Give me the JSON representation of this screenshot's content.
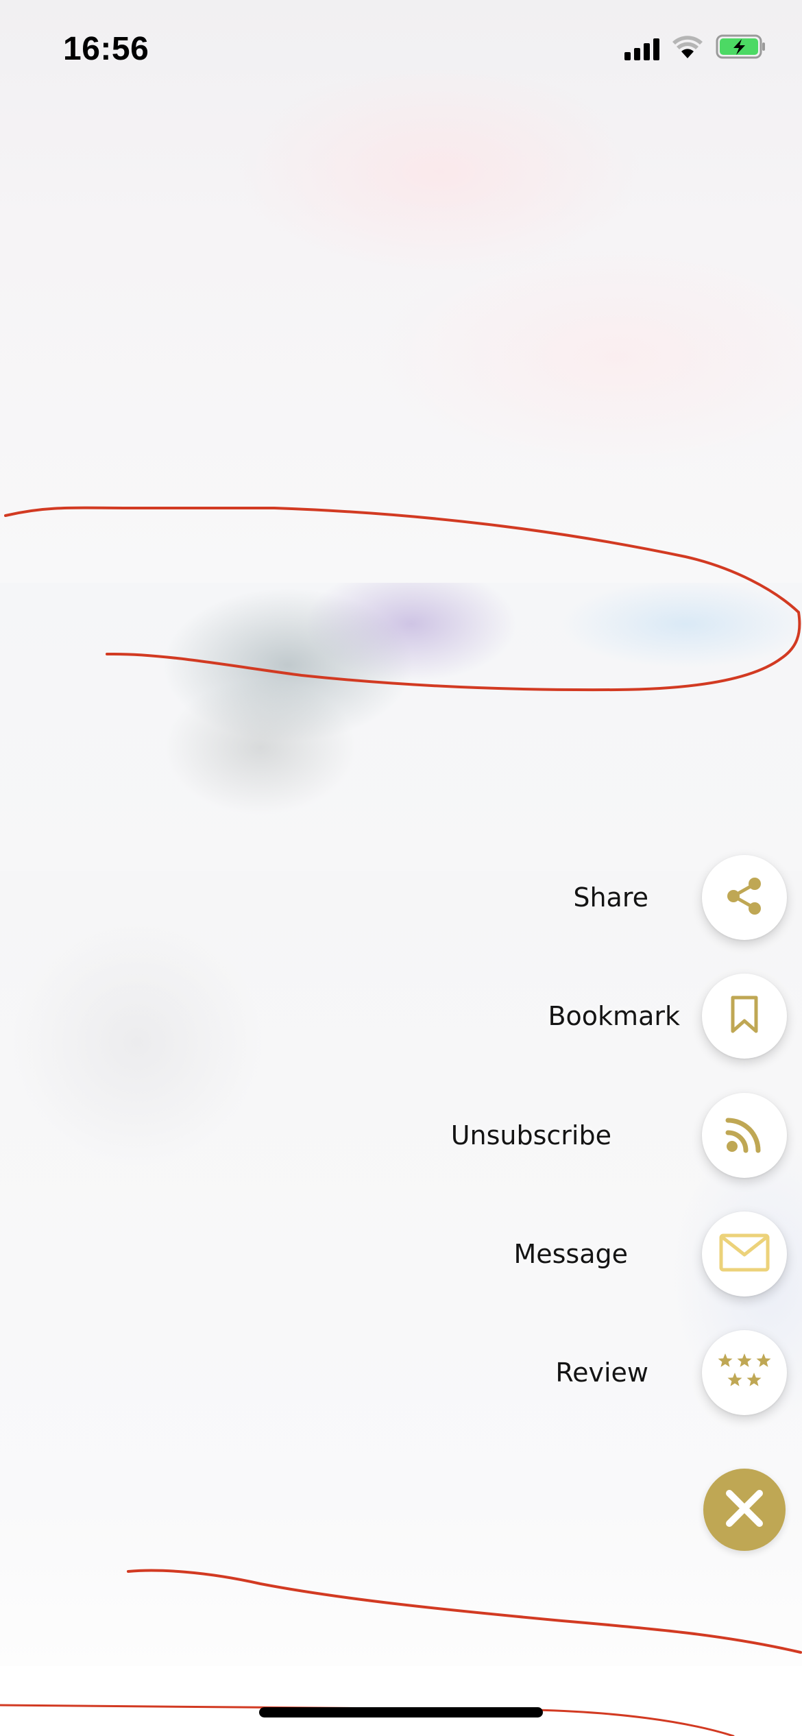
{
  "status_bar": {
    "time": "16:56",
    "icons": [
      "cellular-signal-icon",
      "wifi-icon",
      "battery-charging-icon"
    ]
  },
  "action_menu": {
    "items": [
      {
        "label": "Share",
        "icon": "share-icon"
      },
      {
        "label": "Bookmark",
        "icon": "bookmark-icon"
      },
      {
        "label": "Unsubscribe",
        "icon": "rss-feed-icon"
      },
      {
        "label": "Message",
        "icon": "envelope-icon"
      },
      {
        "label": "Review",
        "icon": "stars-icon"
      }
    ],
    "close_icon": "close-icon"
  },
  "colors": {
    "accent": "#bfa754",
    "message_icon": "#ecd27a",
    "annotation": "#d23a22",
    "battery_fill": "#4cd964"
  }
}
